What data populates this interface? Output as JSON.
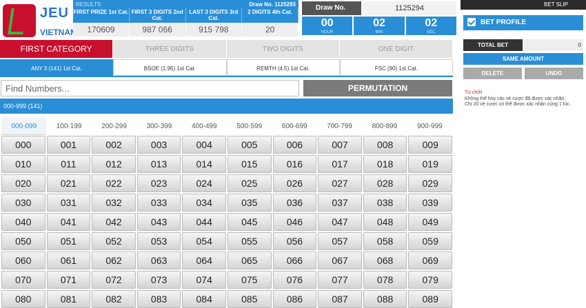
{
  "logo": {
    "text": "JEU",
    "sub": "VIETNAM"
  },
  "results": {
    "title": "RESULTS",
    "draw_no_small": "Draw No. 1125293",
    "headers": [
      "FIRST PRIZE 1st Cat.",
      "FIRST 3 DIGITS 2nd Cat.",
      "LAST 3 DIGITS 3rd Cat.",
      "2 DIGITS 4th Cat."
    ],
    "values": [
      "170609",
      "987   066",
      "915   798",
      "20"
    ]
  },
  "draw": {
    "label": "Draw No.",
    "number": "1125294",
    "timer": [
      {
        "value": "00",
        "unit": "HOUR"
      },
      {
        "value": "02",
        "unit": "MIN"
      },
      {
        "value": "02",
        "unit": "SEC"
      }
    ]
  },
  "categories": [
    "FIRST CATEGORY",
    "THREE DIGITS",
    "TWO DIGITS",
    "ONE DIGIT"
  ],
  "sub_tabs": [
    "ANY 3 (141) 1st Cat.",
    "BSOE (1.95) 1st Cat.",
    "REMTH (4.5) 1st Cat.",
    "FSC (90) 1st Cat."
  ],
  "search": {
    "placeholder": "Find Numbers...",
    "permutation_label": "PERMUTATION"
  },
  "range_bar": "000-999 (141)",
  "ranges": [
    "000-099",
    "100-199",
    "200-299",
    "300-399",
    "400-499",
    "500-599",
    "600-699",
    "700-799",
    "800-899",
    "900-999"
  ],
  "numbers": [
    "000",
    "001",
    "002",
    "003",
    "004",
    "005",
    "006",
    "007",
    "008",
    "009",
    "010",
    "011",
    "012",
    "013",
    "014",
    "015",
    "016",
    "017",
    "018",
    "019",
    "020",
    "021",
    "022",
    "023",
    "024",
    "025",
    "026",
    "027",
    "028",
    "029",
    "030",
    "031",
    "032",
    "033",
    "034",
    "035",
    "036",
    "037",
    "038",
    "039",
    "040",
    "041",
    "042",
    "043",
    "044",
    "045",
    "046",
    "047",
    "048",
    "049",
    "050",
    "051",
    "052",
    "053",
    "054",
    "055",
    "056",
    "057",
    "058",
    "059",
    "060",
    "061",
    "062",
    "063",
    "064",
    "065",
    "066",
    "067",
    "068",
    "069",
    "070",
    "071",
    "072",
    "073",
    "074",
    "075",
    "076",
    "077",
    "078",
    "079",
    "080",
    "081",
    "082",
    "083",
    "084",
    "085",
    "086",
    "087",
    "088",
    "089"
  ],
  "bet_slip": {
    "header": "BET SLIP",
    "profile": "BET PROFILE",
    "total_label": "TOTAL BET",
    "total_value": "0",
    "same_amount": "SAME AMOUNT",
    "delete": "DELETE",
    "undo": "UNDO",
    "notes": [
      "Từ chối!",
      "Không thể hủy các vé cược đã được xác nhận.",
      "Chỉ 20 vé cược có thể được xác nhận cùng 1 lúc."
    ]
  },
  "colors": {
    "accent": "#2a8ed6",
    "brand_red": "#c8102e",
    "dark": "#2b2b2b"
  }
}
